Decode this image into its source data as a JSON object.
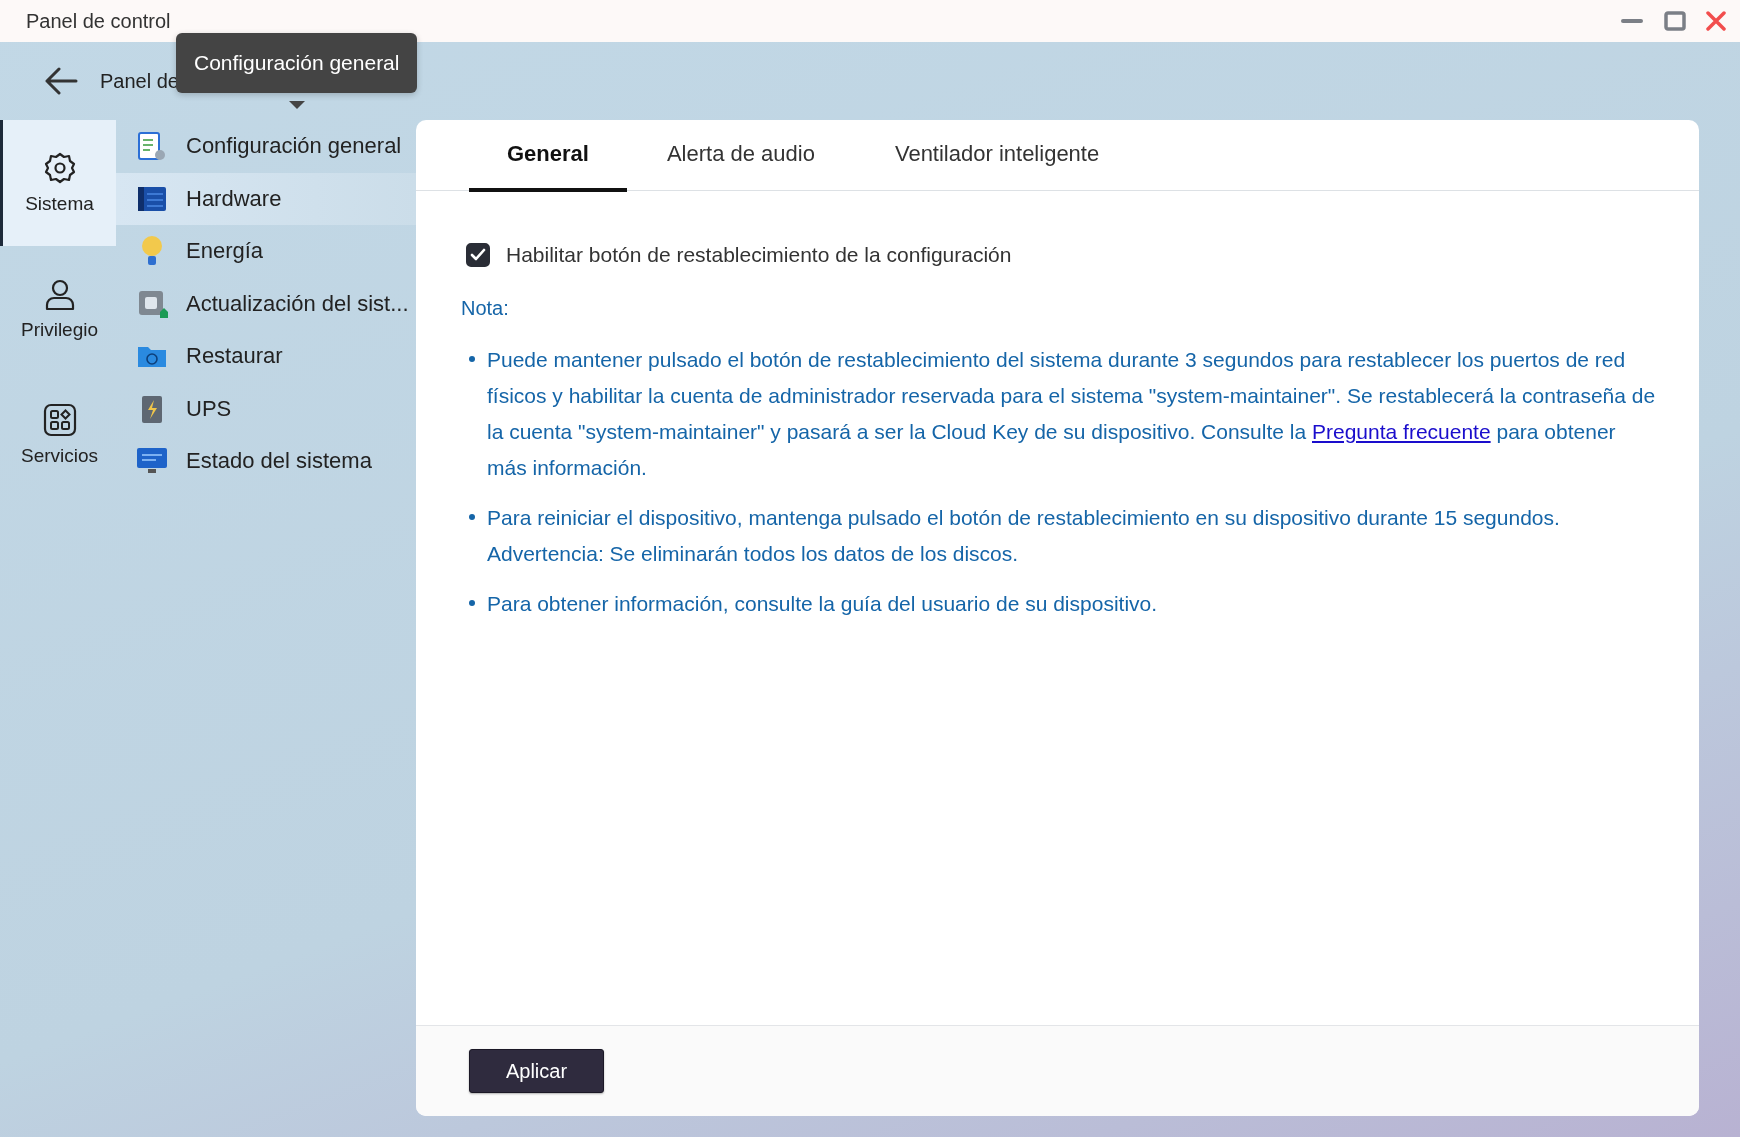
{
  "window": {
    "title": "Panel de control"
  },
  "header": {
    "title": "Panel de"
  },
  "tooltip": {
    "text": "Configuración general"
  },
  "rail": [
    {
      "label": "Sistema",
      "selected": true
    },
    {
      "label": "Privilegio",
      "selected": false
    },
    {
      "label": "Servicios",
      "selected": false
    }
  ],
  "nav": [
    {
      "label": "Configuración general",
      "selected": false
    },
    {
      "label": "Hardware",
      "selected": true
    },
    {
      "label": "Energía",
      "selected": false
    },
    {
      "label": "Actualización del sist...",
      "selected": false
    },
    {
      "label": "Restaurar",
      "selected": false
    },
    {
      "label": "UPS",
      "selected": false
    },
    {
      "label": "Estado del sistema",
      "selected": false
    }
  ],
  "tabs": [
    {
      "label": "General",
      "selected": true
    },
    {
      "label": "Alerta de audio",
      "selected": false
    },
    {
      "label": "Ventilador inteligente",
      "selected": false
    }
  ],
  "checkbox": {
    "label": "Habilitar botón de restablecimiento de la configuración",
    "checked": true
  },
  "note": {
    "title": "Nota:",
    "bullets": [
      {
        "text": "Puede mantener pulsado el botón de restablecimiento del sistema durante 3 segundos para restablecer los puertos de red físicos y habilitar la cuenta de administrador reservada para el sistema \"system-maintainer\". Se restablecerá la contraseña de la cuenta \"system-maintainer\" y pasará a ser la Cloud Key de su dispositivo. Consulte la",
        "link": "Pregunta frecuente",
        "text_after": "para obtener más información."
      },
      {
        "text": "Para reiniciar el dispositivo, mantenga pulsado el botón de restablecimiento en su dispositivo durante 15 segundos. Advertencia: Se eliminarán todos los datos de los discos."
      },
      {
        "text": "Para obtener información, consulte la guía del usuario de su dispositivo."
      }
    ]
  },
  "apply_button": "Aplicar"
}
